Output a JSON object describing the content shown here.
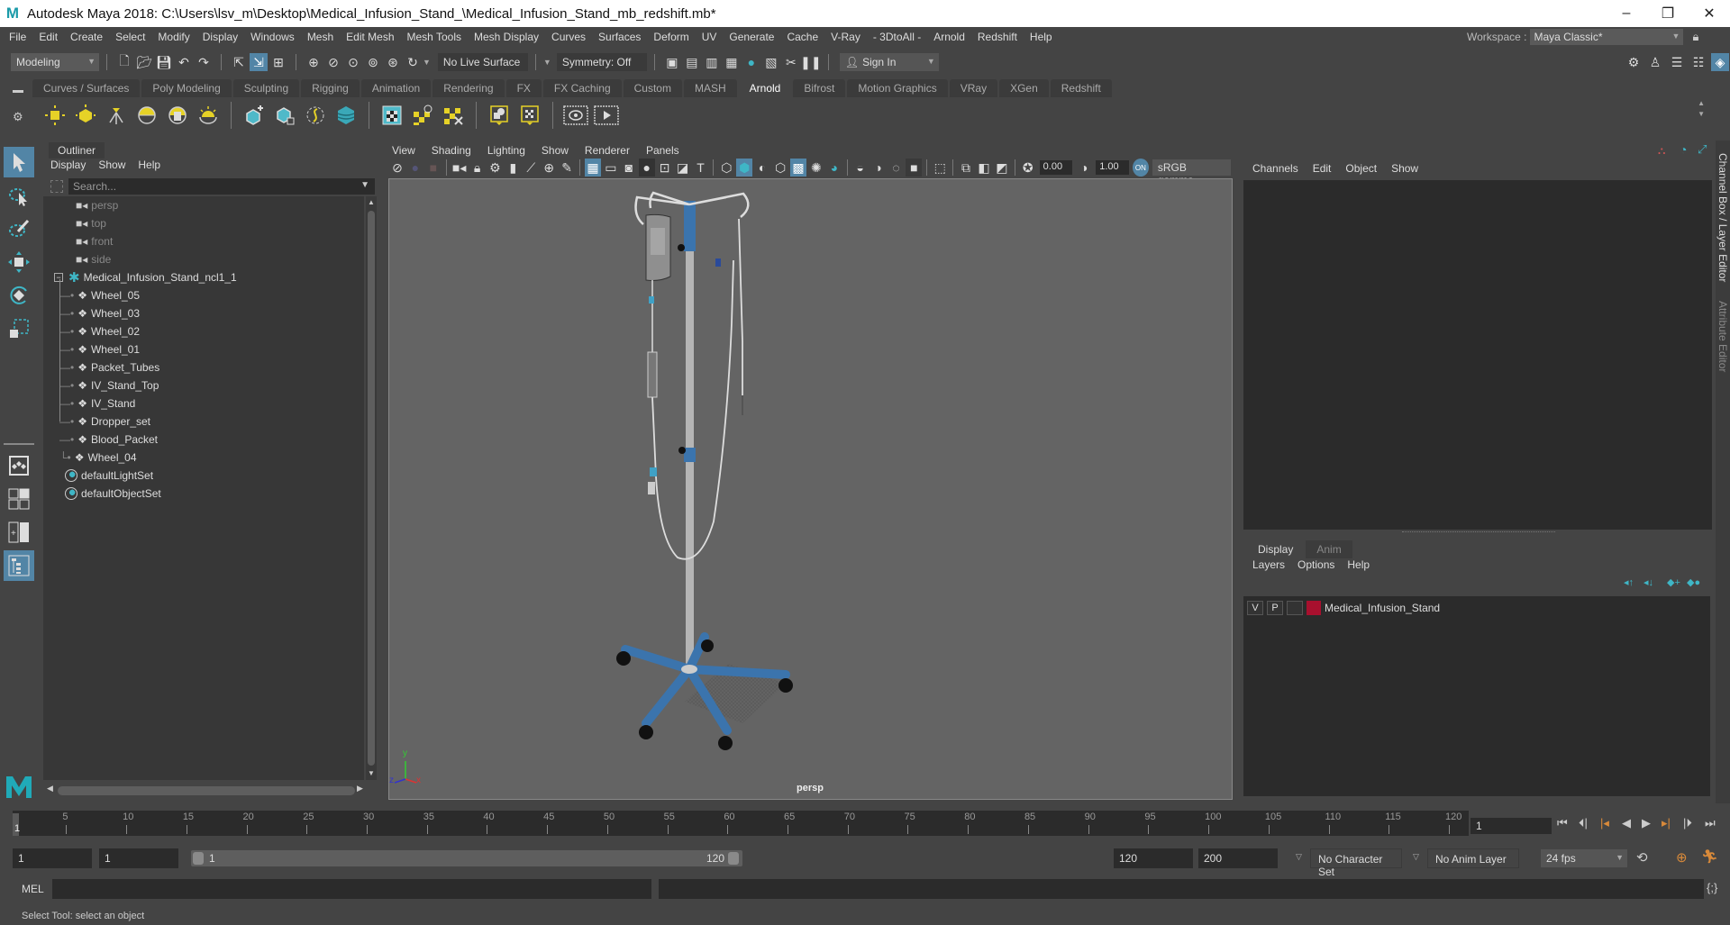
{
  "window": {
    "title": "Autodesk Maya 2018: C:\\Users\\lsv_m\\Desktop\\Medical_Infusion_Stand_\\Medical_Infusion_Stand_mb_redshift.mb*",
    "logo": "M",
    "minimize": "–",
    "maximize": "❐",
    "close": "✕"
  },
  "menubar": {
    "items": [
      "File",
      "Edit",
      "Create",
      "Select",
      "Modify",
      "Display",
      "Windows",
      "Mesh",
      "Edit Mesh",
      "Mesh Tools",
      "Mesh Display",
      "Curves",
      "Surfaces",
      "Deform",
      "UV",
      "Generate",
      "Cache",
      "V-Ray",
      "- 3DtoAll -",
      "Arnold",
      "Redshift",
      "Help"
    ],
    "workspace_label": "Workspace :",
    "workspace_value": "Maya Classic*"
  },
  "statusline": {
    "mode": "Modeling",
    "live_surface": "No Live Surface",
    "symmetry": "Symmetry: Off",
    "sign_in": "Sign In"
  },
  "shelf": {
    "tabs": [
      "Curves / Surfaces",
      "Poly Modeling",
      "Sculpting",
      "Rigging",
      "Animation",
      "Rendering",
      "FX",
      "FX Caching",
      "Custom",
      "MASH",
      "Arnold",
      "Bifrost",
      "Motion Graphics",
      "VRay",
      "XGen",
      "Redshift"
    ],
    "active_tab": "Arnold"
  },
  "outliner": {
    "title": "Outliner",
    "menu": [
      "Display",
      "Show",
      "Help"
    ],
    "search_placeholder": "Search...",
    "cameras": [
      "persp",
      "top",
      "front",
      "side"
    ],
    "group": "Medical_Infusion_Stand_ncl1_1",
    "children": [
      "Wheel_05",
      "Wheel_03",
      "Wheel_02",
      "Wheel_01",
      "Packet_Tubes",
      "IV_Stand_Top",
      "IV_Stand",
      "Dropper_set",
      "Blood_Packet",
      "Wheel_04"
    ],
    "sets": [
      "defaultLightSet",
      "defaultObjectSet"
    ]
  },
  "viewport": {
    "menu": [
      "View",
      "Shading",
      "Lighting",
      "Show",
      "Renderer",
      "Panels"
    ],
    "exposure": "0.00",
    "gamma": "1.00",
    "color_space": "sRGB gamma",
    "camera_label": "persp",
    "axis": {
      "x": "x",
      "y": "y",
      "z": "z"
    }
  },
  "channelbox": {
    "menu": [
      "Channels",
      "Edit",
      "Object",
      "Show"
    ]
  },
  "layereditor": {
    "tabs": [
      "Display",
      "Anim"
    ],
    "active_tab": "Display",
    "menu": [
      "Layers",
      "Options",
      "Help"
    ],
    "layers": [
      {
        "v": "V",
        "p": "P",
        "name": "Medical_Infusion_Stand",
        "color": "#a8102e"
      }
    ]
  },
  "sidetabs": {
    "channel_box": "Channel Box / Layer Editor",
    "attribute_editor": "Attribute Editor"
  },
  "timeslider": {
    "ticks": [
      5,
      10,
      15,
      20,
      25,
      30,
      35,
      40,
      45,
      50,
      55,
      60,
      65,
      70,
      75,
      80,
      85,
      90,
      95,
      100,
      105,
      110,
      115,
      120
    ],
    "current_frame": "1",
    "current_frame_field": "1"
  },
  "rangeslider": {
    "start": "1",
    "anim_start": "1",
    "range_start": "1",
    "range_end": "120",
    "end": "120",
    "anim_end": "200",
    "character_set": "No Character Set",
    "anim_layer": "No Anim Layer",
    "fps": "24 fps"
  },
  "cmdline": {
    "label": "MEL"
  },
  "helpline": {
    "text": "Select Tool: select an object"
  },
  "colors": {
    "accent": "#5285a6",
    "teal": "#3fb6c6",
    "shelf_yellow": "#e6d227",
    "layer_red": "#a8102e"
  }
}
